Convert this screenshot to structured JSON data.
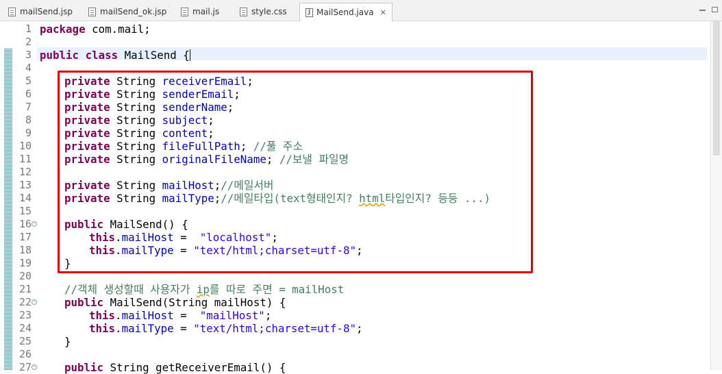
{
  "tabs": [
    {
      "label": "mailSend.jsp",
      "icon": "jsp-file-icon"
    },
    {
      "label": "mailSend_ok.jsp",
      "icon": "jsp-file-icon"
    },
    {
      "label": "mail.js",
      "icon": "js-file-icon"
    },
    {
      "label": "style.css",
      "icon": "css-file-icon"
    },
    {
      "label": "MailSend.java",
      "icon": "java-file-icon",
      "active": true
    }
  ],
  "code": {
    "l1": {
      "n": "1",
      "kw": "package",
      "rest": " com.mail;"
    },
    "l2": {
      "n": "2"
    },
    "l3": {
      "n": "3",
      "kw1": "public",
      "kw2": "class",
      "rest": " MailSend {"
    },
    "l4": {
      "n": "4"
    },
    "l5": {
      "n": "5",
      "kw": "private",
      "type": " String ",
      "field": "receiverEmail",
      "end": ";"
    },
    "l6": {
      "n": "6",
      "kw": "private",
      "type": " String ",
      "field": "senderEmail",
      "end": ";"
    },
    "l7": {
      "n": "7",
      "kw": "private",
      "type": " String ",
      "field": "senderName",
      "end": ";"
    },
    "l8": {
      "n": "8",
      "kw": "private",
      "type": " String ",
      "field": "subject",
      "end": ";"
    },
    "l9": {
      "n": "9",
      "kw": "private",
      "type": " String ",
      "field": "content",
      "end": ";"
    },
    "l10": {
      "n": "10",
      "kw": "private",
      "type": " String ",
      "field": "fileFullPath",
      "end": "; ",
      "comment": "//풀 주소"
    },
    "l11": {
      "n": "11",
      "kw": "private",
      "type": " String ",
      "field": "originalFileName",
      "end": "; ",
      "comment": "//보낼 파일명"
    },
    "l12": {
      "n": "12"
    },
    "l13": {
      "n": "13",
      "kw": "private",
      "type": " String ",
      "field": "mailHost",
      "end": ";",
      "comment": "//메일서버"
    },
    "l14": {
      "n": "14",
      "kw": "private",
      "type": " String ",
      "field": "mailType",
      "end": ";",
      "comment_a": "//메일타입(text형태인지? ",
      "comment_typo": "html",
      "comment_b": "타입인지? 등등 ...)"
    },
    "l15": {
      "n": "15"
    },
    "l16": {
      "n": "16",
      "kw": "public",
      "rest": " MailSend() {"
    },
    "l17": {
      "n": "17",
      "kw": "this",
      "dot": ".",
      "field": "mailHost",
      "mid": " =  ",
      "str": "\"localhost\"",
      "end": ";"
    },
    "l18": {
      "n": "18",
      "kw": "this",
      "dot": ".",
      "field": "mailType",
      "mid": " = ",
      "str": "\"text/html;charset=utf-8\"",
      "end": ";"
    },
    "l19": {
      "n": "19",
      "rest": "}"
    },
    "l20": {
      "n": "20"
    },
    "l21": {
      "n": "21",
      "comment_a": "//객체 생성할때 사용자가 ",
      "comment_typo": "ip",
      "comment_b": "를 따로 주면 = mailHost"
    },
    "l22": {
      "n": "22",
      "kw": "public",
      "rest": " MailSend(String mailHost) {"
    },
    "l23": {
      "n": "23",
      "kw": "this",
      "dot": ".",
      "field": "mailHost",
      "mid": " =  ",
      "str": "\"mailHost\"",
      "end": ";"
    },
    "l24": {
      "n": "24",
      "kw": "this",
      "dot": ".",
      "field": "mailType",
      "mid": " = ",
      "str": "\"text/html;charset=utf-8\"",
      "end": ";"
    },
    "l25": {
      "n": "25",
      "rest": "}"
    },
    "l26": {
      "n": "26"
    },
    "l27": {
      "n": "27",
      "kw": "public",
      "rest": " String getReceiverEmail() {"
    }
  },
  "colors": {
    "keyword": "#7f0055",
    "field": "#0000c0",
    "string": "#2a00ff",
    "comment": "#3f7f5f",
    "highlight_box": "#e60000"
  }
}
